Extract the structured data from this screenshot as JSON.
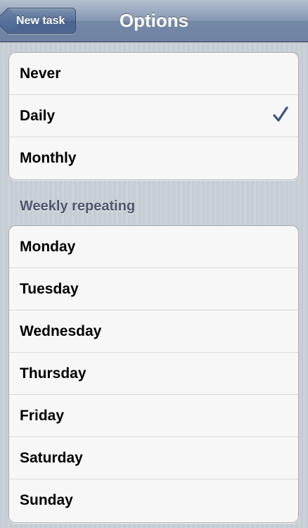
{
  "navbar": {
    "title": "Options",
    "back_label": "New task"
  },
  "repeat_options": {
    "items": [
      {
        "label": "Never",
        "checked": false
      },
      {
        "label": "Daily",
        "checked": true
      },
      {
        "label": "Monthly",
        "checked": false
      }
    ],
    "selected": "Daily"
  },
  "weekly": {
    "header": "Weekly repeating",
    "days": [
      {
        "label": "Monday"
      },
      {
        "label": "Tuesday"
      },
      {
        "label": "Wednesday"
      },
      {
        "label": "Thursday"
      },
      {
        "label": "Friday"
      },
      {
        "label": "Saturday"
      },
      {
        "label": "Sunday"
      }
    ]
  },
  "colors": {
    "navbar": "#7489a7",
    "checkmark": "#385487",
    "section_header": "#4c566c",
    "background": "#c5ccd4"
  },
  "icons": {
    "back": "back-chevron-icon",
    "check": "checkmark-icon"
  }
}
